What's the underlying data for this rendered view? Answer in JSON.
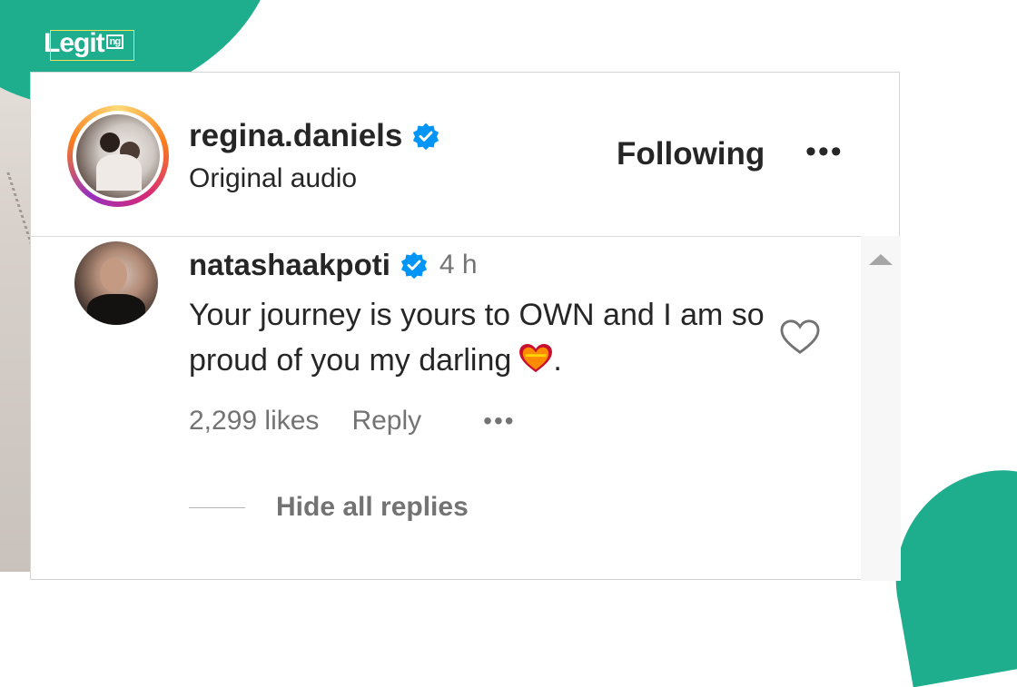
{
  "brand": {
    "logo_text": "Legit",
    "logo_suffix": "ng"
  },
  "post": {
    "username": "regina.daniels",
    "subtitle": "Original audio",
    "follow_label": "Following",
    "more": "•••"
  },
  "comment": {
    "username": "natashaakpoti",
    "time": "4 h",
    "text": "Your journey is yours to OWN and I am so proud of you my darling",
    "text_end": ".",
    "likes": "2,299 likes",
    "reply_label": "Reply",
    "more": "•••",
    "hide_replies": "Hide all replies"
  },
  "colors": {
    "brand_green": "#1fae8d",
    "verified_blue": "#0095f6",
    "text_primary": "#262626",
    "text_secondary": "#737373"
  }
}
